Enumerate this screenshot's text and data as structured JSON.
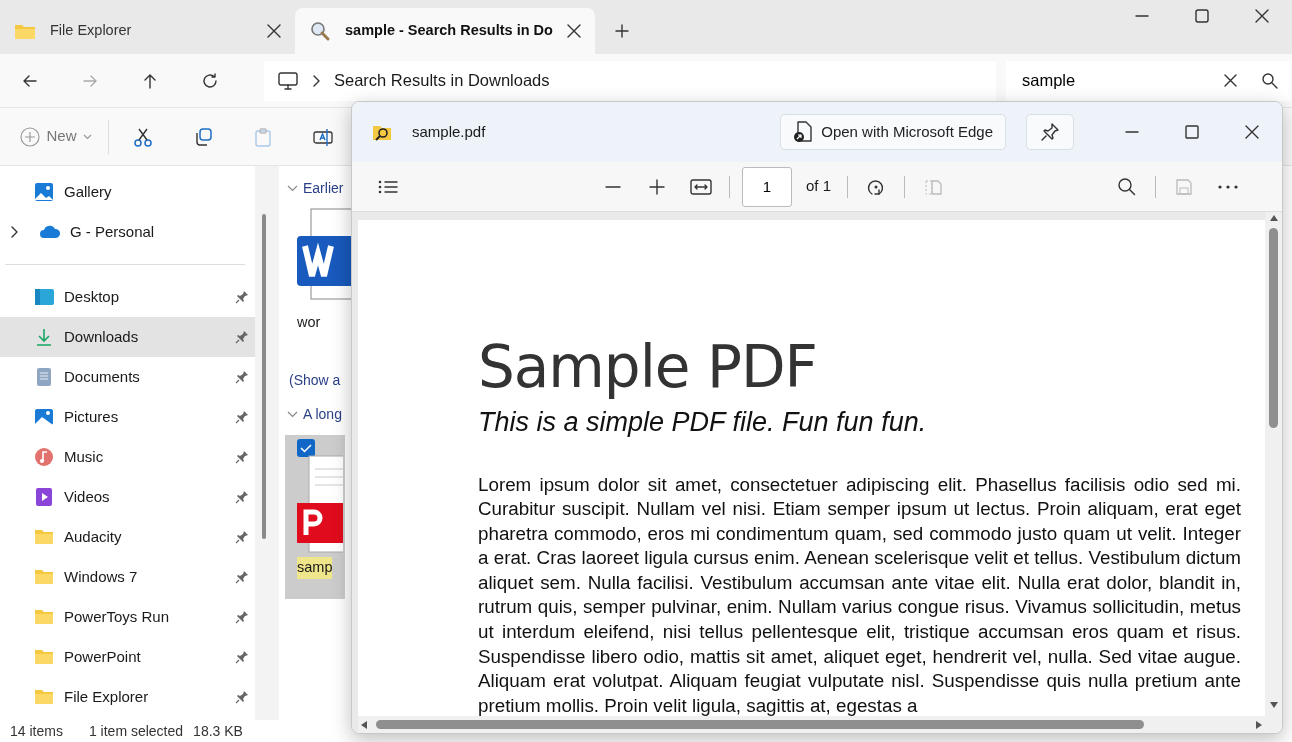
{
  "tabs": [
    {
      "label": "File Explorer",
      "selected": false
    },
    {
      "label": "sample - Search Results in Do",
      "selected": true
    }
  ],
  "address": {
    "crumb": "Search Results in Downloads"
  },
  "search": {
    "value": "sample"
  },
  "toolbar": {
    "new_label": "New"
  },
  "sidebar": {
    "groups": [
      {
        "items": [
          {
            "label": "Gallery",
            "kind": "gallery",
            "expandable": false,
            "pinned": false,
            "selected": false
          },
          {
            "label": "G - Personal",
            "kind": "cloud",
            "expandable": true,
            "pinned": false,
            "selected": false
          }
        ]
      },
      {
        "items": [
          {
            "label": "Desktop",
            "kind": "desktop",
            "expandable": false,
            "pinned": true,
            "selected": false
          },
          {
            "label": "Downloads",
            "kind": "downloads",
            "expandable": false,
            "pinned": true,
            "selected": true
          },
          {
            "label": "Documents",
            "kind": "documents",
            "expandable": false,
            "pinned": true,
            "selected": false
          },
          {
            "label": "Pictures",
            "kind": "pictures",
            "expandable": false,
            "pinned": true,
            "selected": false
          },
          {
            "label": "Music",
            "kind": "music",
            "expandable": false,
            "pinned": true,
            "selected": false
          },
          {
            "label": "Videos",
            "kind": "videos",
            "expandable": false,
            "pinned": true,
            "selected": false
          },
          {
            "label": "Audacity",
            "kind": "folder",
            "expandable": false,
            "pinned": true,
            "selected": false
          },
          {
            "label": "Windows 7",
            "kind": "folder",
            "expandable": false,
            "pinned": true,
            "selected": false
          },
          {
            "label": "PowerToys Run",
            "kind": "folder",
            "expandable": false,
            "pinned": true,
            "selected": false
          },
          {
            "label": "PowerPoint",
            "kind": "folder",
            "expandable": false,
            "pinned": true,
            "selected": false
          },
          {
            "label": "File Explorer",
            "kind": "folder",
            "expandable": false,
            "pinned": true,
            "selected": false
          }
        ]
      }
    ]
  },
  "content": {
    "sections": [
      {
        "heading": "Earlier",
        "expanded": true,
        "files": [
          {
            "name": "wor",
            "kind": "word",
            "selected": false
          }
        ],
        "more_link": "(Show a"
      },
      {
        "heading": "A long",
        "expanded": true,
        "files": [
          {
            "name": "samp",
            "kind": "pdf",
            "selected": true
          }
        ]
      }
    ]
  },
  "status_bar": {
    "items": "14 items",
    "selection": "1 item selected",
    "size": "18.3 KB"
  },
  "preview": {
    "title": "sample.pdf",
    "open_button": "Open with Microsoft Edge",
    "page": "1",
    "page_count": "of 1",
    "document": {
      "title": "Sample PDF",
      "subtitle": "This is a simple PDF file. Fun fun fun.",
      "body": "Lorem ipsum dolor sit amet, consectetuer adipiscing elit. Phasellus facilisis odio sed mi. Curabitur suscipit. Nullam vel nisi. Etiam semper ipsum ut lectus. Proin aliquam, erat eget pharetra commodo, eros mi condimentum quam, sed commodo justo quam ut velit. Integer a erat. Cras laoreet ligula cursus enim. Aenean scelerisque velit et tellus. Vestibulum dictum aliquet sem. Nulla facilisi. Vestibulum accumsan ante vitae elit. Nulla erat dolor, blandit in, rutrum quis, semper pulvinar, enim. Nullam varius congue risus. Vivamus sollicitudin, metus ut interdum eleifend, nisi tellus pellentesque elit, tristique accumsan eros quam et risus. Suspendisse libero odio, mattis sit amet, aliquet eget, hendrerit vel, nulla. Sed vitae augue. Aliquam erat volutpat. Aliquam feugiat vulputate nisl. Suspendisse quis nulla pretium ante pretium mollis. Proin velit ligula, sagittis at, egestas a"
    }
  }
}
